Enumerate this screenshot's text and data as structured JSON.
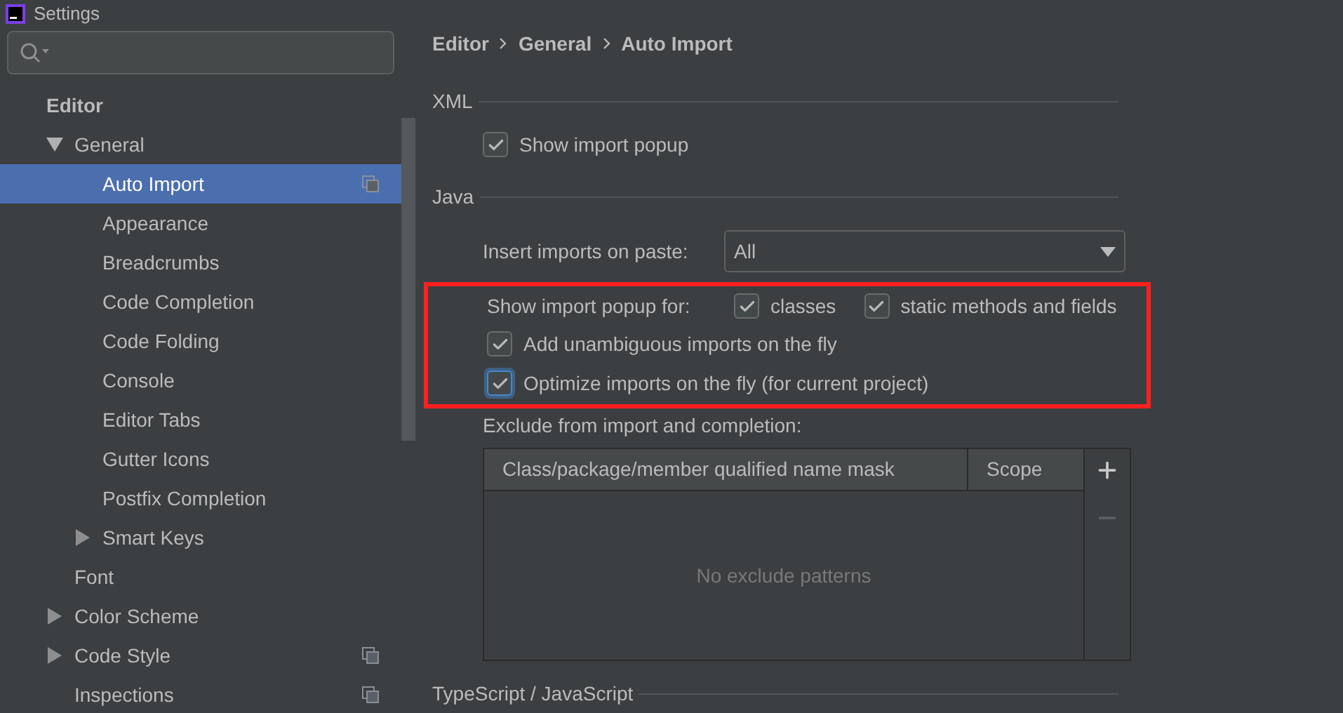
{
  "window": {
    "title": "Settings"
  },
  "sidebar": {
    "items": [
      {
        "label": "Editor",
        "kind": "category",
        "children": [
          {
            "label": "General",
            "kind": "page",
            "expanded": true,
            "project_icon": false,
            "selected": false,
            "children": [
              {
                "label": "Auto Import",
                "kind": "page",
                "project_icon": true,
                "selected": true
              },
              {
                "label": "Appearance",
                "kind": "page",
                "project_icon": false,
                "selected": false
              },
              {
                "label": "Breadcrumbs",
                "kind": "page",
                "project_icon": false,
                "selected": false
              },
              {
                "label": "Code Completion",
                "kind": "page",
                "project_icon": false,
                "selected": false
              },
              {
                "label": "Code Folding",
                "kind": "page",
                "project_icon": false,
                "selected": false
              },
              {
                "label": "Console",
                "kind": "page",
                "project_icon": false,
                "selected": false
              },
              {
                "label": "Editor Tabs",
                "kind": "page",
                "project_icon": false,
                "selected": false
              },
              {
                "label": "Gutter Icons",
                "kind": "page",
                "project_icon": false,
                "selected": false
              },
              {
                "label": "Postfix Completion",
                "kind": "page",
                "project_icon": false,
                "selected": false
              },
              {
                "label": "Smart Keys",
                "kind": "page",
                "expanded": false,
                "project_icon": false,
                "selected": false
              }
            ]
          },
          {
            "label": "Font",
            "kind": "page",
            "project_icon": false,
            "selected": false
          },
          {
            "label": "Color Scheme",
            "kind": "page",
            "expanded": false,
            "project_icon": false,
            "selected": false
          },
          {
            "label": "Code Style",
            "kind": "page",
            "expanded": false,
            "project_icon": true,
            "selected": false
          },
          {
            "label": "Inspections",
            "kind": "page",
            "project_icon": true,
            "selected": false
          }
        ]
      }
    ]
  },
  "breadcrumb": [
    "Editor",
    "General",
    "Auto Import"
  ],
  "sections": [
    {
      "title": "XML",
      "rows": [
        {
          "kind": "checkbox",
          "label": "Show import popup",
          "checked": true,
          "focused": false
        }
      ]
    },
    {
      "title": "Java",
      "rows": [
        {
          "kind": "select",
          "label": "Insert imports on paste:",
          "value": "All"
        },
        {
          "kind": "highlight_group",
          "rows": [
            {
              "kind": "checkbox_group",
              "label": "Show import popup for:",
              "options": [
                {
                  "label": "classes",
                  "checked": true
                },
                {
                  "label": "static methods and fields",
                  "checked": true
                }
              ]
            },
            {
              "kind": "checkbox",
              "label": "Add unambiguous imports on the fly",
              "checked": true,
              "focused": false
            },
            {
              "kind": "checkbox",
              "label": "Optimize imports on the fly (for current project)",
              "checked": true,
              "focused": true
            }
          ]
        },
        {
          "kind": "table",
          "label": "Exclude from import and completion:",
          "columns": [
            "Class/package/member qualified name mask",
            "Scope"
          ],
          "empty_text": "No exclude patterns",
          "actions": [
            {
              "kind": "add",
              "disabled": false
            },
            {
              "kind": "remove",
              "disabled": true
            }
          ]
        }
      ]
    },
    {
      "title": "TypeScript / JavaScript"
    }
  ]
}
